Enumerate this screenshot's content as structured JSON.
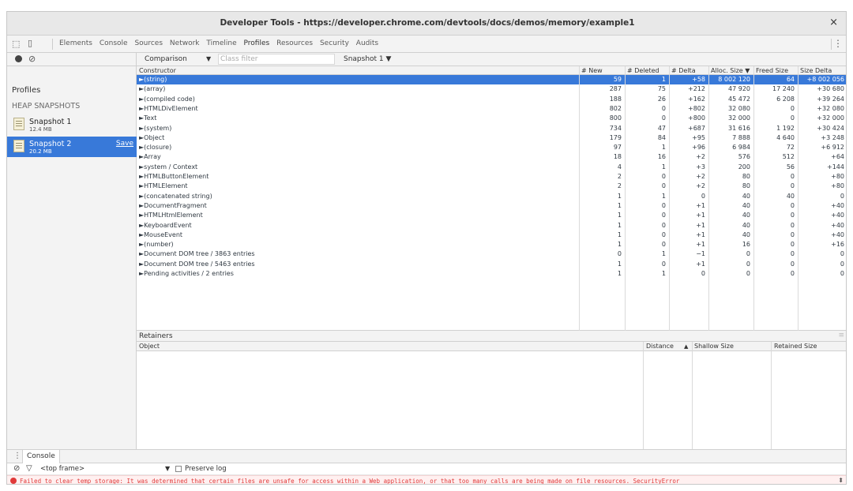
{
  "window": {
    "title": "Developer Tools - https://developer.chrome.com/devtools/docs/demos/memory/example1",
    "close_glyph": "×"
  },
  "toolbar": {
    "tabs": [
      "Elements",
      "Console",
      "Sources",
      "Network",
      "Timeline",
      "Profiles",
      "Resources",
      "Security",
      "Audits"
    ],
    "active_tab": "Profiles",
    "more_glyph": "⋮"
  },
  "sidebar": {
    "profiles_label": "Profiles",
    "heap_label": "HEAP SNAPSHOTS",
    "snapshots": [
      {
        "name": "Snapshot 1",
        "size": "12.4 MB"
      },
      {
        "name": "Snapshot 2",
        "size": "20.2 MB",
        "action": "Save"
      }
    ]
  },
  "filterbar": {
    "view": "Comparison",
    "view_caret": "▼",
    "class_filter_placeholder": "Class filter",
    "base_snapshot": "Snapshot 1 ▼"
  },
  "grid": {
    "columns": [
      "Constructor",
      "# New",
      "# Deleted",
      "# Delta",
      "Alloc. Size ▼",
      "Freed Size",
      "Size Delta"
    ],
    "rows": [
      [
        "►(string)",
        "59",
        "1",
        "+58",
        "8 002 120",
        "64",
        "+8 002 056"
      ],
      [
        "►(array)",
        "287",
        "75",
        "+212",
        "47 920",
        "17 240",
        "+30 680"
      ],
      [
        "►(compiled code)",
        "188",
        "26",
        "+162",
        "45 472",
        "6 208",
        "+39 264"
      ],
      [
        "►HTMLDivElement",
        "802",
        "0",
        "+802",
        "32 080",
        "0",
        "+32 080"
      ],
      [
        "►Text",
        "800",
        "0",
        "+800",
        "32 000",
        "0",
        "+32 000"
      ],
      [
        "►(system)",
        "734",
        "47",
        "+687",
        "31 616",
        "1 192",
        "+30 424"
      ],
      [
        "►Object",
        "179",
        "84",
        "+95",
        "7 888",
        "4 640",
        "+3 248"
      ],
      [
        "►(closure)",
        "97",
        "1",
        "+96",
        "6 984",
        "72",
        "+6 912"
      ],
      [
        "►Array",
        "18",
        "16",
        "+2",
        "576",
        "512",
        "+64"
      ],
      [
        "►system / Context",
        "4",
        "1",
        "+3",
        "200",
        "56",
        "+144"
      ],
      [
        "►HTMLButtonElement",
        "2",
        "0",
        "+2",
        "80",
        "0",
        "+80"
      ],
      [
        "►HTMLElement",
        "2",
        "0",
        "+2",
        "80",
        "0",
        "+80"
      ],
      [
        "►(concatenated string)",
        "1",
        "1",
        "0",
        "40",
        "40",
        "0"
      ],
      [
        "►DocumentFragment",
        "1",
        "0",
        "+1",
        "40",
        "0",
        "+40"
      ],
      [
        "►HTMLHtmlElement",
        "1",
        "0",
        "+1",
        "40",
        "0",
        "+40"
      ],
      [
        "►KeyboardEvent",
        "1",
        "0",
        "+1",
        "40",
        "0",
        "+40"
      ],
      [
        "►MouseEvent",
        "1",
        "0",
        "+1",
        "40",
        "0",
        "+40"
      ],
      [
        "►(number)",
        "1",
        "0",
        "+1",
        "16",
        "0",
        "+16"
      ],
      [
        "►Document DOM tree / 3863 entries",
        "0",
        "1",
        "−1",
        "0",
        "0",
        "0"
      ],
      [
        "►Document DOM tree / 5463 entries",
        "1",
        "0",
        "+1",
        "0",
        "0",
        "0"
      ],
      [
        "►Pending activities / 2 entries",
        "1",
        "1",
        "0",
        "0",
        "0",
        "0"
      ]
    ]
  },
  "retainers": {
    "title": "Retainers",
    "grip": "≡",
    "columns": [
      "Object",
      "Distance",
      "▲",
      "Shallow Size",
      "Retained Size"
    ]
  },
  "drawer": {
    "more_glyph": "⋮",
    "tab": "Console",
    "context": "<top frame>",
    "context_caret": "▼",
    "preserve_log": "Preserve log",
    "error": "Failed to clear temp storage: It was determined that certain files are unsafe for access within a Web application, or that too many calls are being made on file resources. SecurityError",
    "scroll_glyph": "⬍"
  },
  "colors": {
    "selection": "#3879d9",
    "error": "#e03a3a"
  }
}
